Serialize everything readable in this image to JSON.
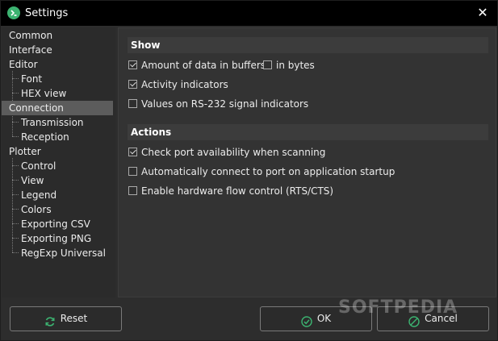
{
  "window": {
    "title": "Settings"
  },
  "sidebar": {
    "items": [
      {
        "label": "Common"
      },
      {
        "label": "Interface"
      },
      {
        "label": "Editor"
      },
      {
        "label": "Font"
      },
      {
        "label": "HEX view"
      },
      {
        "label": "Connection"
      },
      {
        "label": "Transmission"
      },
      {
        "label": "Reception"
      },
      {
        "label": "Plotter"
      },
      {
        "label": "Control"
      },
      {
        "label": "View"
      },
      {
        "label": "Legend"
      },
      {
        "label": "Colors"
      },
      {
        "label": "Exporting CSV"
      },
      {
        "label": "Exporting PNG"
      },
      {
        "label": "RegExp Universal"
      }
    ],
    "selected": "Connection"
  },
  "show": {
    "title": "Show",
    "amount_of_data": {
      "label": "Amount of data in buffers",
      "checked": true
    },
    "in_bytes": {
      "label": "in bytes",
      "checked": false
    },
    "activity_indicators": {
      "label": "Activity indicators",
      "checked": true
    },
    "rs232_values": {
      "label": "Values on RS-232 signal indicators",
      "checked": false
    }
  },
  "actions": {
    "title": "Actions",
    "check_port": {
      "label": "Check port availability when scanning",
      "checked": true
    },
    "auto_connect": {
      "label": "Automatically connect to port on application startup",
      "checked": false
    },
    "flow_control": {
      "label": "Enable hardware flow control (RTS/CTS)",
      "checked": false
    }
  },
  "buttons": {
    "reset": "Reset",
    "ok": "OK",
    "cancel": "Cancel"
  },
  "watermark": "SOFTPEDIA"
}
